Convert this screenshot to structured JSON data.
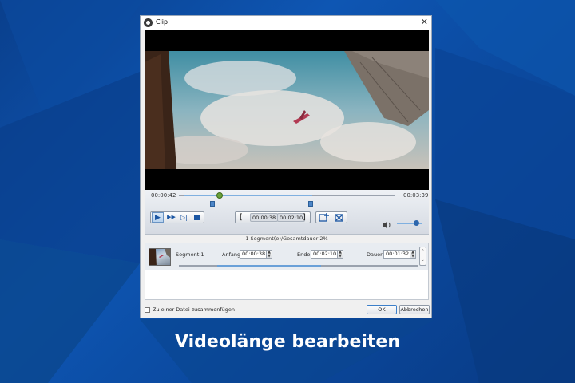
{
  "window": {
    "title": "Clip",
    "close_glyph": "✕"
  },
  "player": {
    "current_time": "00:00:42",
    "total_time": "00:03:39",
    "position_fraction": 0.19,
    "play_glyph": "▶",
    "fast_forward_glyph": "▶▶",
    "step_glyph": "▷|",
    "mark_in_glyph": "[",
    "mark_out_glyph": "]",
    "start_code": "00:00:38",
    "end_code": "00:02:10",
    "volume_fraction": 0.75
  },
  "status_text": "1 Segment(e)/Gesamtdauer 2%",
  "segment": {
    "label": "Segment 1",
    "start_label": "Anfang:",
    "start_value": "00:00:38",
    "end_label": "Ende:",
    "end_value": "00:02:10",
    "duration_label": "Dauer:",
    "duration_value": "00:01:32"
  },
  "footer": {
    "merge_label": "Zu einer Datei zusammenfügen",
    "ok_label": "OK",
    "cancel_label": "Abbrechen"
  },
  "caption": "Videolänge bearbeiten",
  "colors": {
    "background": "#0e56b3",
    "accent": "#1b56a3",
    "thumb_green": "#6aa23a"
  },
  "icons": [
    "close-icon",
    "app-icon",
    "play-icon",
    "fast-forward-icon",
    "step-forward-icon",
    "stop-icon",
    "add-segment-icon",
    "remove-segment-icon",
    "volume-icon",
    "spin-up-icon",
    "spin-down-icon"
  ]
}
